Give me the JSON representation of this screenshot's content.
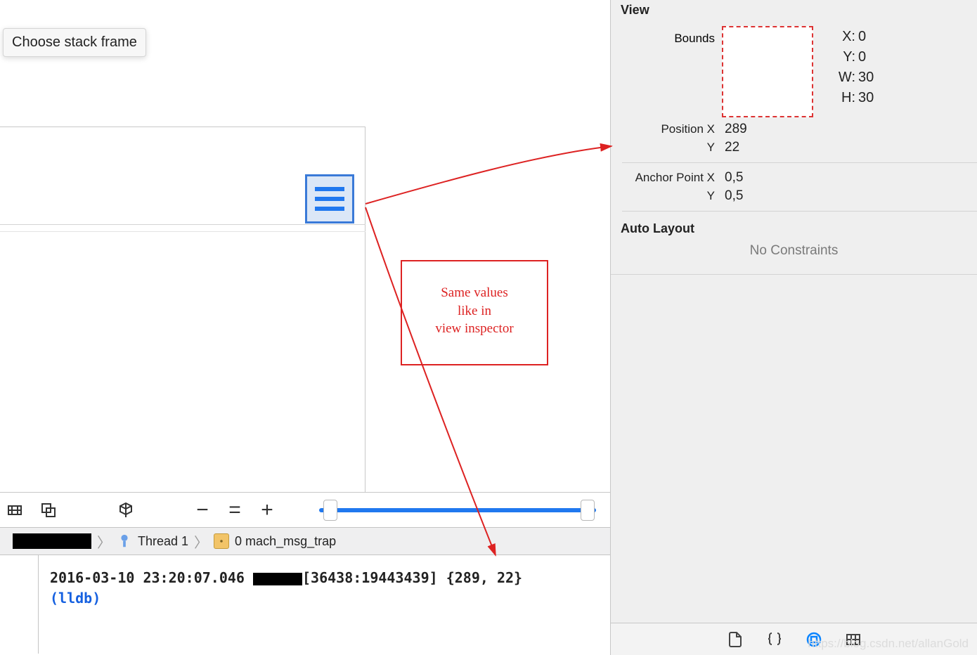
{
  "popup": {
    "choose_frame": "Choose stack frame"
  },
  "inspector": {
    "section_view": "View",
    "bounds_label": "Bounds",
    "bounds": {
      "x_label": "X:",
      "x": "0",
      "y_label": "Y:",
      "y": "0",
      "w_label": "W:",
      "w": "30",
      "h_label": "H:",
      "h": "30"
    },
    "position_x_label": "Position X",
    "position_x": "289",
    "position_y_label": "Y",
    "position_y": "22",
    "anchor_x_label": "Anchor Point X",
    "anchor_x": "0,5",
    "anchor_y_label": "Y",
    "anchor_y": "0,5",
    "auto_layout": "Auto Layout",
    "no_constraints": "No Constraints"
  },
  "breadcrumb": {
    "thread": "Thread 1",
    "frame": "0 mach_msg_trap"
  },
  "console": {
    "ts": "2016-03-10 23:20:07.046",
    "bracket": "[36438:19443439]",
    "value": "{289, 22}",
    "prompt": "(lldb)"
  },
  "annotation": {
    "l1": "Same values",
    "l2": "like in",
    "l3": "view inspector"
  },
  "watermark": "https://blog.csdn.net/allanGold"
}
